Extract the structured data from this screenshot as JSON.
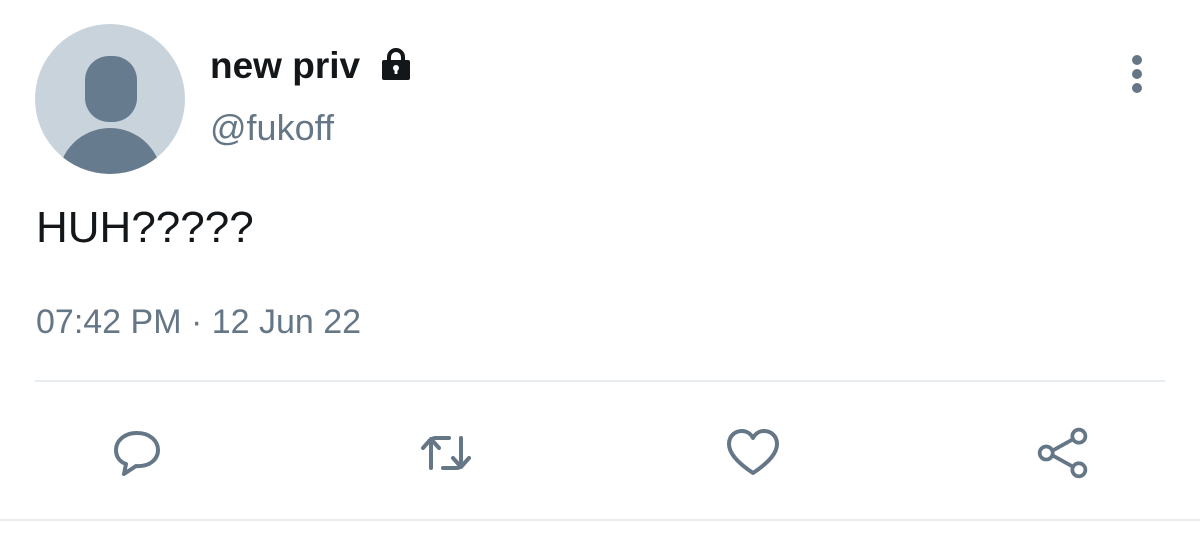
{
  "author": {
    "display_name": "new priv",
    "handle": "@fukoff",
    "protected_icon": "lock-icon"
  },
  "tweet": {
    "text": "HUH?????",
    "timestamp": "07:42 PM · 12 Jun 22"
  },
  "actions": {
    "reply_icon": "speech-bubble-icon",
    "retweet_icon": "retweet-icon",
    "like_icon": "heart-icon",
    "share_icon": "share-icon",
    "more_icon": "vertical-dots-icon"
  },
  "colors": {
    "primary_text": "#14171a",
    "secondary_text": "#657786",
    "avatar_bg": "#c9d3dc",
    "avatar_fg": "#677b8e",
    "divider": "#e6ecf0"
  }
}
